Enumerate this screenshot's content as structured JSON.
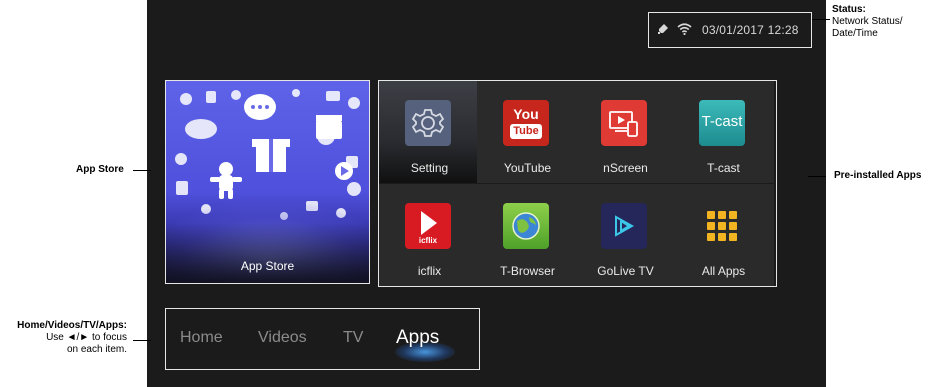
{
  "status": {
    "datetime": "03/01/2017 12:28",
    "icons": [
      "usb-icon",
      "wifi-icon"
    ]
  },
  "app_store_tile": {
    "label": "App Store"
  },
  "apps": [
    {
      "label": "Setting",
      "icon": "gear-icon",
      "color": "#5b6a8a"
    },
    {
      "label": "YouTube",
      "icon": "youtube-icon",
      "color": "#d42a1f"
    },
    {
      "label": "nScreen",
      "icon": "nscreen-icon",
      "color": "#e23a36"
    },
    {
      "label": "T-cast",
      "icon": "tcast-icon",
      "color": "#2aa7a8"
    },
    {
      "label": "icflix",
      "icon": "icflix-icon",
      "color": "#d91c24"
    },
    {
      "label": "T-Browser",
      "icon": "browser-icon",
      "color": "#6bbf3a"
    },
    {
      "label": "GoLive TV",
      "icon": "golive-icon",
      "color": "#2b2c5e"
    },
    {
      "label": "All Apps",
      "icon": "grid-icon",
      "color": "#f2b521"
    }
  ],
  "youtube_icon_text": {
    "line1": "You",
    "line2": "Tube"
  },
  "tcast_icon_text": "T-cast",
  "icflix_icon_text": "icflix",
  "nav": {
    "items": [
      "Home",
      "Videos",
      "TV",
      "Apps"
    ],
    "active": "Apps"
  },
  "callouts": {
    "status_title": "Status:",
    "status_l1": "Network Status/",
    "status_l2": "Date/Time",
    "appstore": "App Store",
    "preinstalled": "Pre-installed Apps",
    "nav_title": "Home/Videos/TV/Apps:",
    "nav_l1": "Use ◄/► to focus",
    "nav_l2": "on each item."
  }
}
